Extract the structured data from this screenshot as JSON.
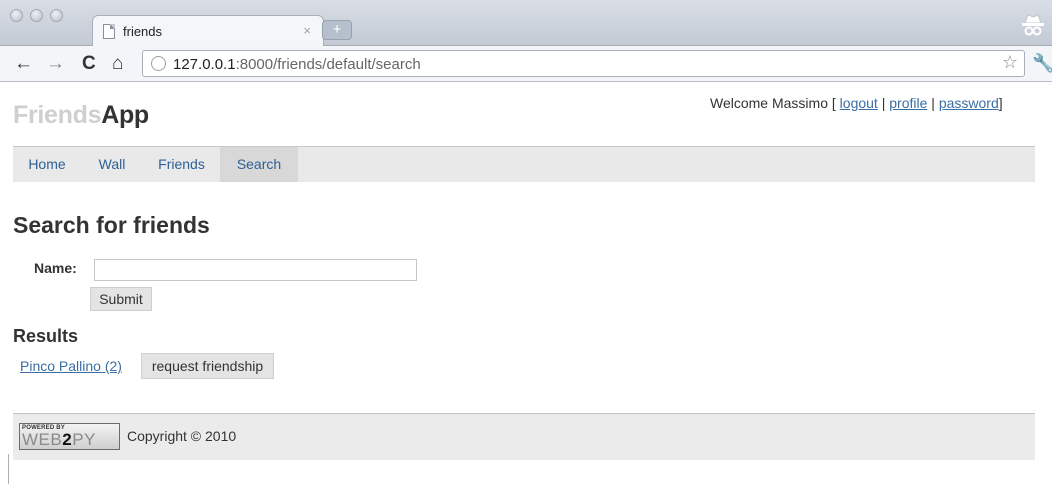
{
  "browser": {
    "tab_title": "friends",
    "tab_close": "×",
    "new_tab": "+",
    "url_host": "127.0.0.1",
    "url_rest": ":8000/friends/default/search",
    "icons": [
      "back-icon",
      "forward-icon",
      "reload-icon",
      "home-icon",
      "globe-icon",
      "star-icon",
      "wrench-icon",
      "incognito-icon",
      "new-tab-icon"
    ]
  },
  "header": {
    "logo_pre": "Friends",
    "logo_post": "App",
    "welcome": "Welcome Massimo [",
    "logout": "logout",
    "sep": "|",
    "profile": "profile",
    "password": "password",
    "close_bracket": "]"
  },
  "menu": {
    "items": [
      {
        "label": "Home"
      },
      {
        "label": "Wall"
      },
      {
        "label": "Friends"
      },
      {
        "label": "Search"
      }
    ],
    "active": "Search"
  },
  "main": {
    "title": "Search for friends",
    "name_label": "Name:",
    "name_value": "",
    "submit_label": "Submit",
    "results_title": "Results",
    "results": [
      {
        "name": "Pinco Pallino (2)",
        "action": "request friendship"
      }
    ]
  },
  "footer": {
    "badge_small": "POWERED BY",
    "badge_web": "WEB",
    "badge_two": "2",
    "badge_py": "PY",
    "copyright": "Copyright © 2010"
  }
}
